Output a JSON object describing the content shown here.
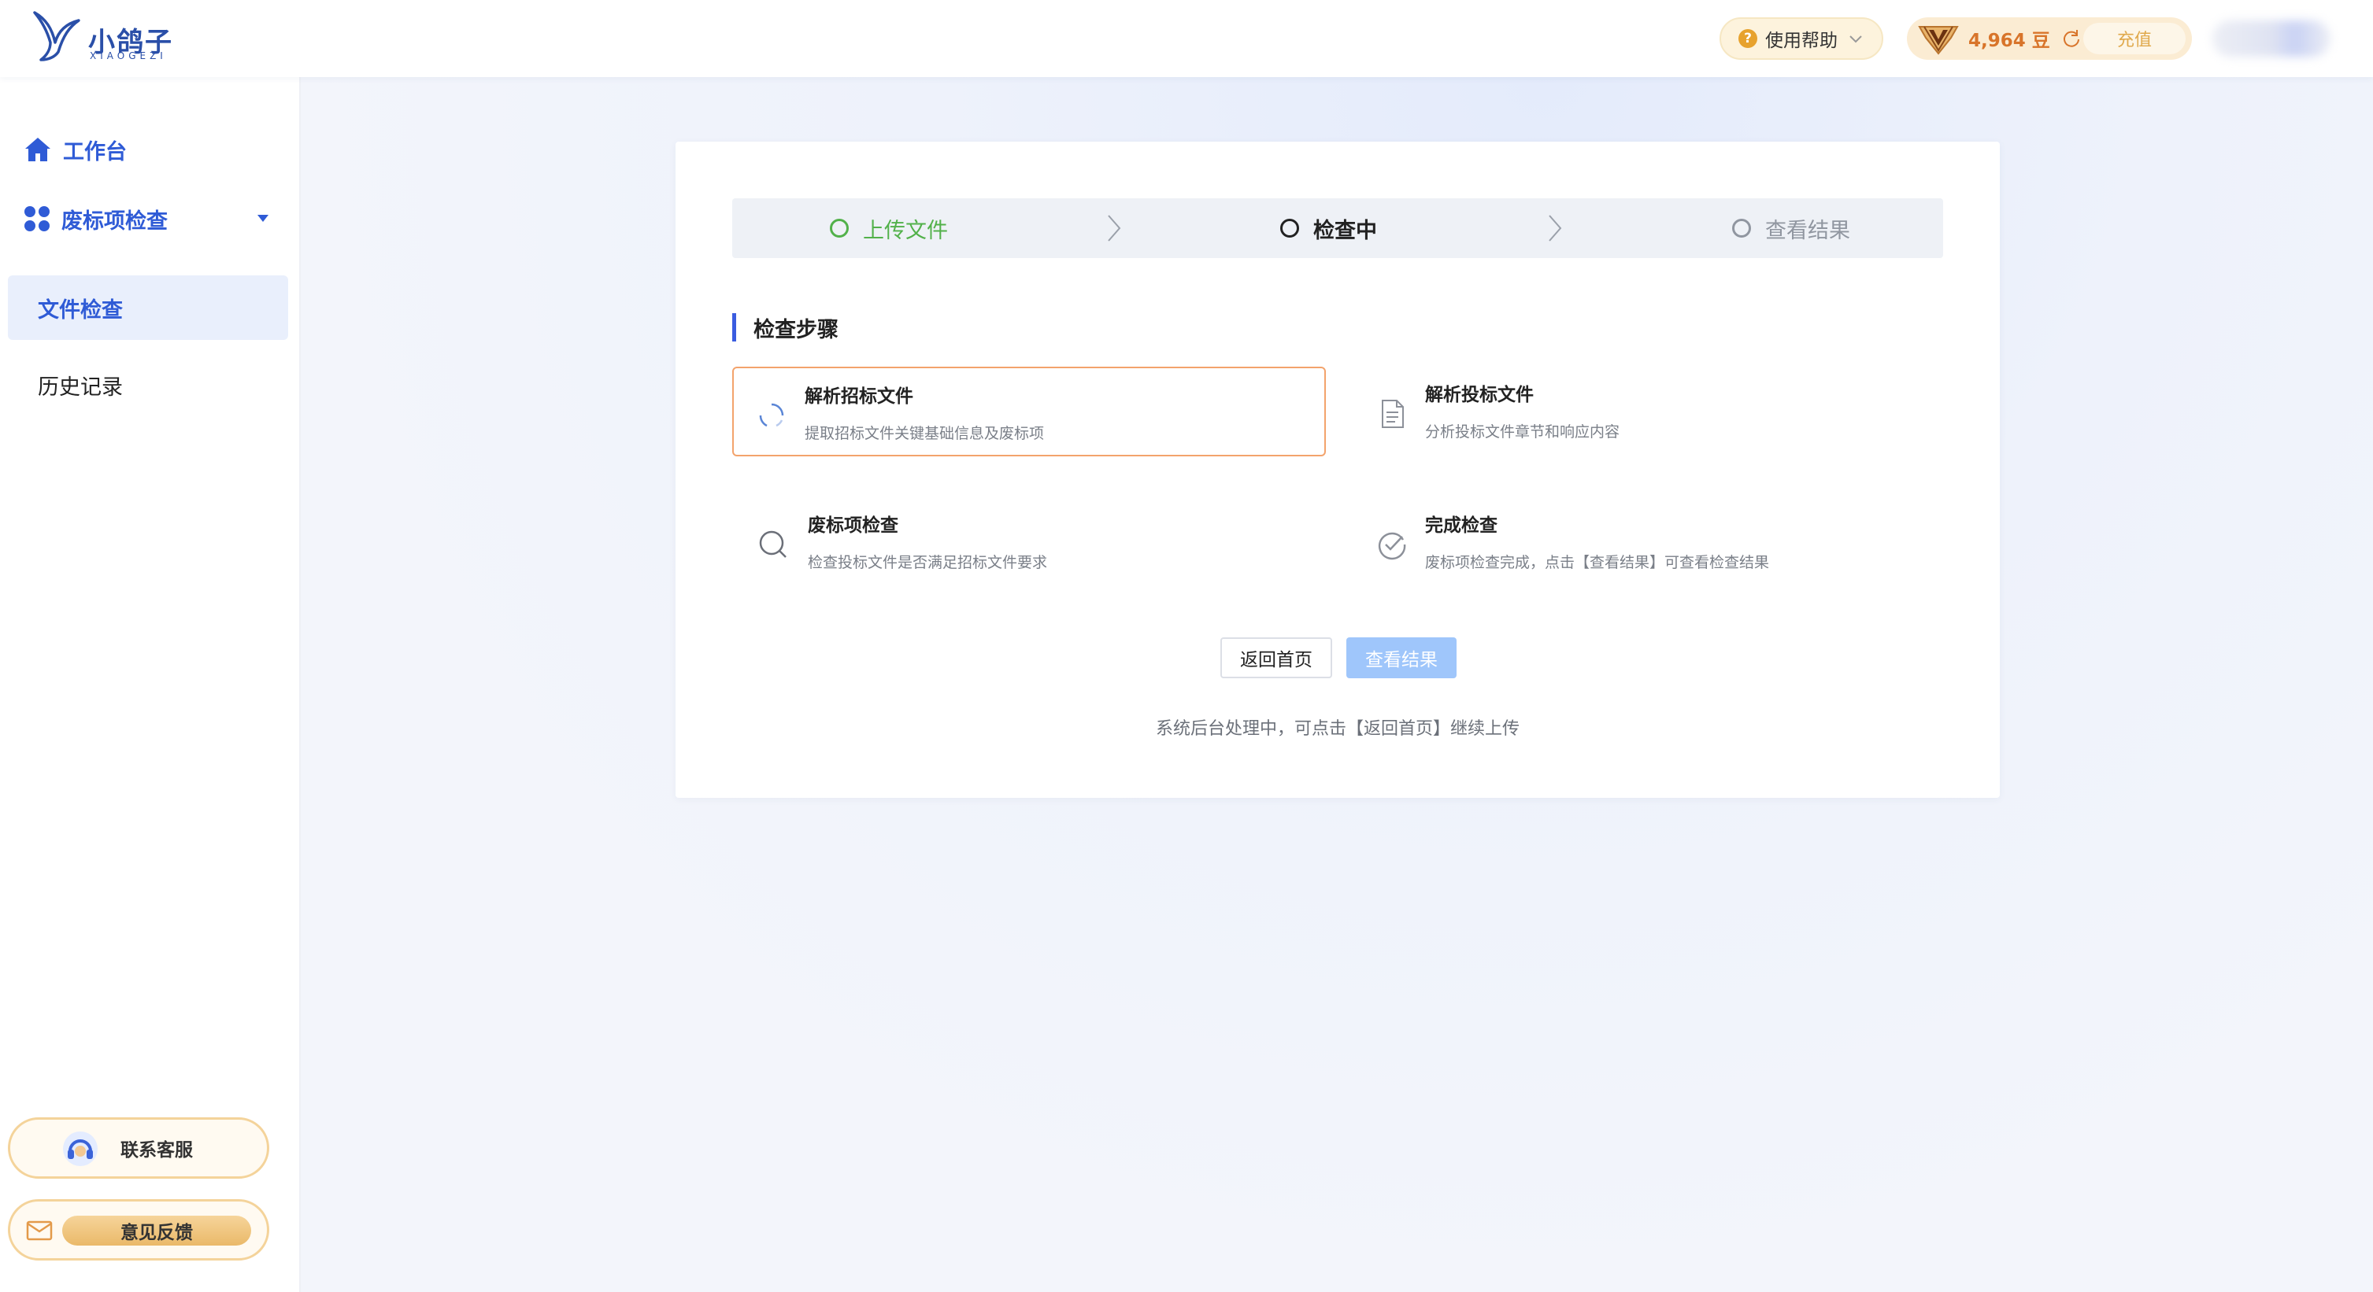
{
  "header": {
    "logo_name": "小鸽子",
    "logo_sub": "XIAOGEZI",
    "help_label": "使用帮助",
    "help_icon": "question-circle-icon",
    "balance": "4,964 豆",
    "recharge_label": "充值"
  },
  "sidebar": {
    "workbench_label": "工作台",
    "group_label": "废标项检查",
    "items": [
      {
        "label": "文件检查",
        "active": true
      },
      {
        "label": "历史记录",
        "active": false
      }
    ],
    "support_label": "联系客服",
    "feedback_label": "意见反馈"
  },
  "steps": [
    {
      "label": "上传文件",
      "state": "done"
    },
    {
      "label": "检查中",
      "state": "current"
    },
    {
      "label": "查看结果",
      "state": "todo"
    }
  ],
  "section_title": "检查步骤",
  "tasks": [
    {
      "title": "解析招标文件",
      "desc": "提取招标文件关键基础信息及废标项",
      "icon": "loading-spinner-icon",
      "active": true
    },
    {
      "title": "解析投标文件",
      "desc": "分析投标文件章节和响应内容",
      "icon": "document-icon",
      "active": false
    },
    {
      "title": "废标项检查",
      "desc": "检查投标文件是否满足招标文件要求",
      "icon": "search-icon",
      "active": false
    },
    {
      "title": "完成检查",
      "desc": "废标项检查完成，点击【查看结果】可查看检查结果",
      "icon": "check-circle-icon",
      "active": false
    }
  ],
  "buttons": {
    "home": "返回首页",
    "result": "查看结果"
  },
  "note": "系统后台处理中，可点击【返回首页】继续上传",
  "colors": {
    "accent": "#2f5bd6",
    "done": "#52b14a",
    "active_border": "#f3a36c",
    "disabled_button": "#9fc6fb"
  }
}
